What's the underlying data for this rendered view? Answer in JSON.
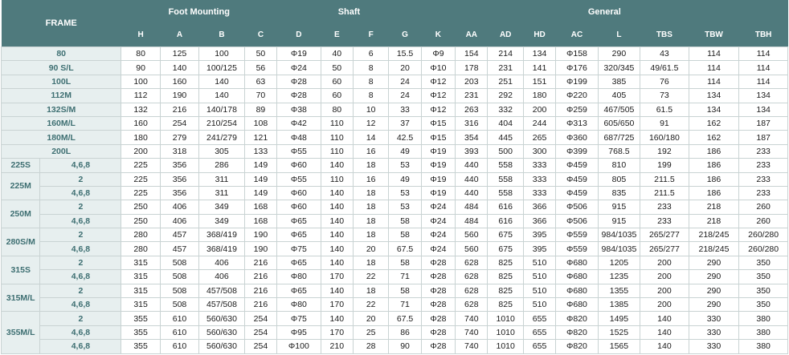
{
  "header": {
    "frame": "FRAME",
    "groups": [
      {
        "label": "Foot Mounting",
        "span": 4
      },
      {
        "label": "Shaft",
        "span": 4
      },
      {
        "label": "General",
        "span": 8
      }
    ],
    "columns": [
      "H",
      "A",
      "B",
      "C",
      "D",
      "E",
      "F",
      "G",
      "K",
      "AA",
      "AD",
      "HD",
      "AC",
      "L",
      "TBS",
      "TBW",
      "TBH"
    ]
  },
  "rows": [
    {
      "frame": "80",
      "cells": [
        "80",
        "125",
        "100",
        "50",
        "Φ19",
        "40",
        "6",
        "15.5",
        "Φ9",
        "154",
        "214",
        "134",
        "Φ158",
        "290",
        "43",
        "114",
        "114"
      ]
    },
    {
      "frame": "90 S/L",
      "cells": [
        "90",
        "140",
        "100/125",
        "56",
        "Φ24",
        "50",
        "8",
        "20",
        "Φ10",
        "178",
        "231",
        "141",
        "Φ176",
        "320/345",
        "49/61.5",
        "114",
        "114"
      ]
    },
    {
      "frame": "100L",
      "cells": [
        "100",
        "160",
        "140",
        "63",
        "Φ28",
        "60",
        "8",
        "24",
        "Φ12",
        "203",
        "251",
        "151",
        "Φ199",
        "385",
        "76",
        "114",
        "114"
      ]
    },
    {
      "frame": "112M",
      "cells": [
        "112",
        "190",
        "140",
        "70",
        "Φ28",
        "60",
        "8",
        "24",
        "Φ12",
        "231",
        "292",
        "180",
        "Φ220",
        "405",
        "73",
        "134",
        "134"
      ]
    },
    {
      "frame": "132S/M",
      "cells": [
        "132",
        "216",
        "140/178",
        "89",
        "Φ38",
        "80",
        "10",
        "33",
        "Φ12",
        "263",
        "332",
        "200",
        "Φ259",
        "467/505",
        "61.5",
        "134",
        "134"
      ]
    },
    {
      "frame": "160M/L",
      "cells": [
        "160",
        "254",
        "210/254",
        "108",
        "Φ42",
        "110",
        "12",
        "37",
        "Φ15",
        "316",
        "404",
        "244",
        "Φ313",
        "605/650",
        "91",
        "162",
        "187"
      ]
    },
    {
      "frame": "180M/L",
      "cells": [
        "180",
        "279",
        "241/279",
        "121",
        "Φ48",
        "110",
        "14",
        "42.5",
        "Φ15",
        "354",
        "445",
        "265",
        "Φ360",
        "687/725",
        "160/180",
        "162",
        "187"
      ]
    },
    {
      "frame": "200L",
      "cells": [
        "200",
        "318",
        "305",
        "133",
        "Φ55",
        "110",
        "16",
        "49",
        "Φ19",
        "393",
        "500",
        "300",
        "Φ399",
        "768.5",
        "192",
        "186",
        "233"
      ]
    },
    {
      "frame": "225S",
      "pole": "4,6,8",
      "cells": [
        "225",
        "356",
        "286",
        "149",
        "Φ60",
        "140",
        "18",
        "53",
        "Φ19",
        "440",
        "558",
        "333",
        "Φ459",
        "810",
        "199",
        "186",
        "233"
      ]
    },
    {
      "frame": "225M",
      "pole": "2",
      "cells": [
        "225",
        "356",
        "311",
        "149",
        "Φ55",
        "110",
        "16",
        "49",
        "Φ19",
        "440",
        "558",
        "333",
        "Φ459",
        "805",
        "211.5",
        "186",
        "233"
      ]
    },
    {
      "pole": "4,6,8",
      "cells": [
        "225",
        "356",
        "311",
        "149",
        "Φ60",
        "140",
        "18",
        "53",
        "Φ19",
        "440",
        "558",
        "333",
        "Φ459",
        "835",
        "211.5",
        "186",
        "233"
      ]
    },
    {
      "frame": "250M",
      "pole": "2",
      "cells": [
        "250",
        "406",
        "349",
        "168",
        "Φ60",
        "140",
        "18",
        "53",
        "Φ24",
        "484",
        "616",
        "366",
        "Φ506",
        "915",
        "233",
        "218",
        "260"
      ]
    },
    {
      "pole": "4,6,8",
      "cells": [
        "250",
        "406",
        "349",
        "168",
        "Φ65",
        "140",
        "18",
        "58",
        "Φ24",
        "484",
        "616",
        "366",
        "Φ506",
        "915",
        "233",
        "218",
        "260"
      ]
    },
    {
      "frame": "280S/M",
      "pole": "2",
      "cells": [
        "280",
        "457",
        "368/419",
        "190",
        "Φ65",
        "140",
        "18",
        "58",
        "Φ24",
        "560",
        "675",
        "395",
        "Φ559",
        "984/1035",
        "265/277",
        "218/245",
        "260/280"
      ]
    },
    {
      "pole": "4,6,8",
      "cells": [
        "280",
        "457",
        "368/419",
        "190",
        "Φ75",
        "140",
        "20",
        "67.5",
        "Φ24",
        "560",
        "675",
        "395",
        "Φ559",
        "984/1035",
        "265/277",
        "218/245",
        "260/280"
      ]
    },
    {
      "frame": "315S",
      "pole": "2",
      "cells": [
        "315",
        "508",
        "406",
        "216",
        "Φ65",
        "140",
        "18",
        "58",
        "Φ28",
        "628",
        "825",
        "510",
        "Φ680",
        "1205",
        "200",
        "290",
        "350"
      ]
    },
    {
      "pole": "4,6,8",
      "cells": [
        "315",
        "508",
        "406",
        "216",
        "Φ80",
        "170",
        "22",
        "71",
        "Φ28",
        "628",
        "825",
        "510",
        "Φ680",
        "1235",
        "200",
        "290",
        "350"
      ]
    },
    {
      "frame": "315M/L",
      "pole": "2",
      "cells": [
        "315",
        "508",
        "457/508",
        "216",
        "Φ65",
        "140",
        "18",
        "58",
        "Φ28",
        "628",
        "825",
        "510",
        "Φ680",
        "1355",
        "200",
        "290",
        "350"
      ]
    },
    {
      "pole": "4,6,8",
      "cells": [
        "315",
        "508",
        "457/508",
        "216",
        "Φ80",
        "170",
        "22",
        "71",
        "Φ28",
        "628",
        "825",
        "510",
        "Φ680",
        "1385",
        "200",
        "290",
        "350"
      ]
    },
    {
      "frame": "355M/L",
      "pole": "2",
      "cells": [
        "355",
        "610",
        "560/630",
        "254",
        "Φ75",
        "140",
        "20",
        "67.5",
        "Φ28",
        "740",
        "1010",
        "655",
        "Φ820",
        "1495",
        "140",
        "330",
        "380"
      ]
    },
    {
      "pole": "4,6,8",
      "cells": [
        "355",
        "610",
        "560/630",
        "254",
        "Φ95",
        "170",
        "25",
        "86",
        "Φ28",
        "740",
        "1010",
        "655",
        "Φ820",
        "1525",
        "140",
        "330",
        "380"
      ]
    },
    {
      "pole": "4,6,8",
      "cells": [
        "355",
        "610",
        "560/630",
        "254",
        "Φ100",
        "210",
        "28",
        "90",
        "Φ28",
        "740",
        "1010",
        "655",
        "Φ820",
        "1565",
        "140",
        "330",
        "380"
      ]
    }
  ],
  "colors": {
    "header_bg": "#4f7a7d",
    "label_bg": "#e7efef",
    "label_text": "#3e6f72"
  }
}
